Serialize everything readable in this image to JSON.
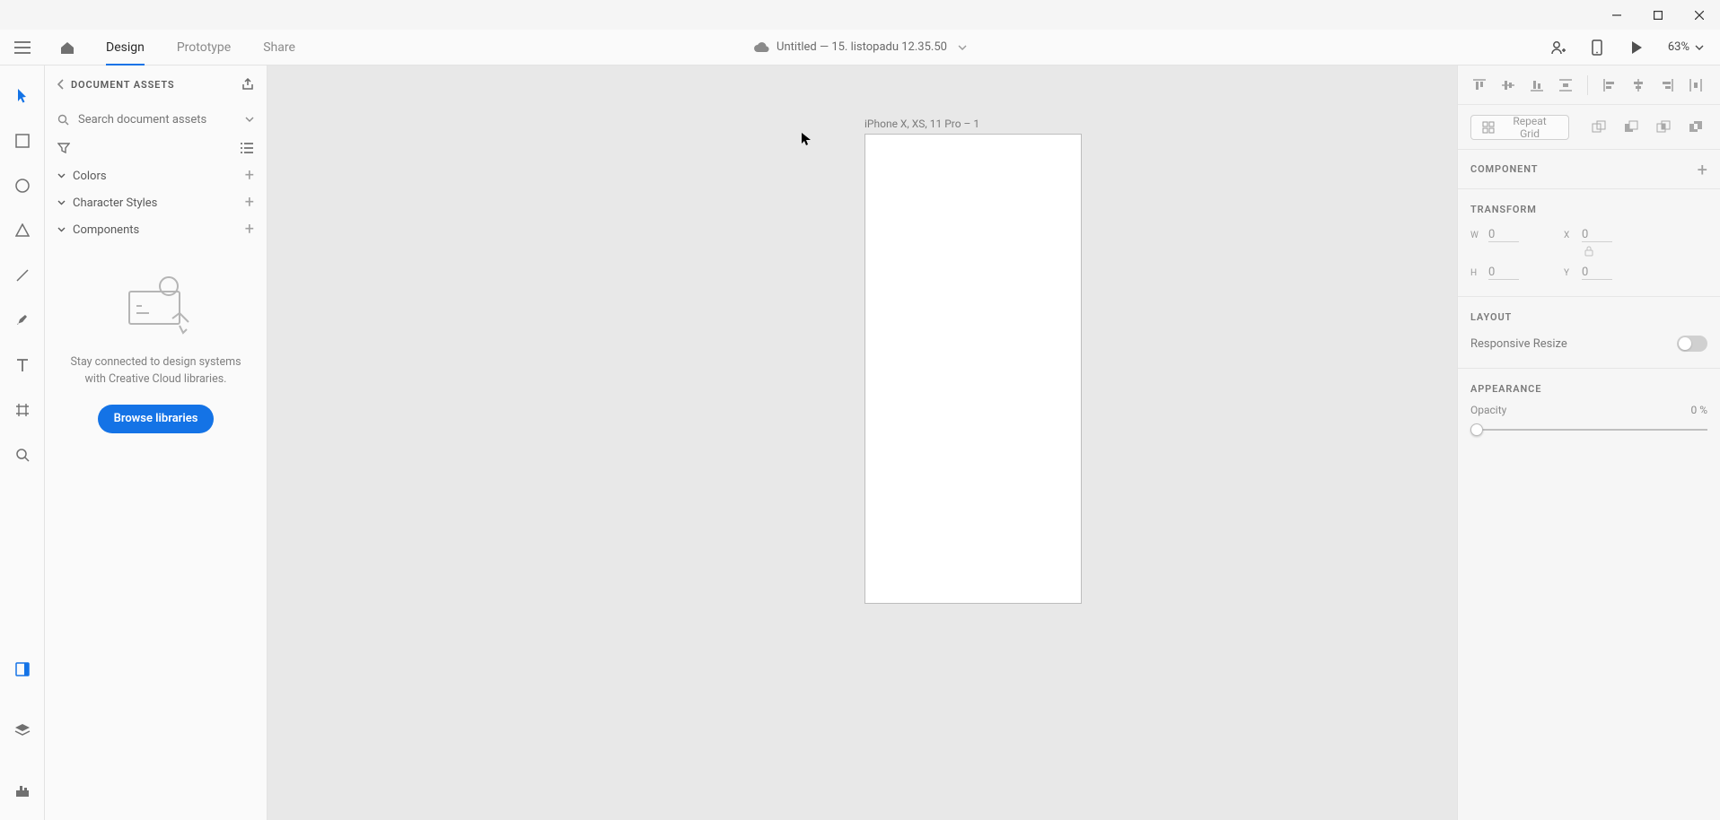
{
  "window": {
    "title": ""
  },
  "header": {
    "tabs": [
      "Design",
      "Prototype",
      "Share"
    ],
    "active_tab": 0,
    "doc_title": "Untitled — 15. listopadu 12.35.50",
    "zoom_label": "63%"
  },
  "assets": {
    "title": "DOCUMENT ASSETS",
    "search_placeholder": "Search document assets",
    "sections": {
      "colors": "Colors",
      "chars": "Character Styles",
      "components": "Components"
    },
    "empty_msg": "Stay connected to design systems with Creative Cloud libraries.",
    "browse_btn": "Browse libraries"
  },
  "canvas": {
    "artboard_label": "iPhone X, XS, 11 Pro – 1"
  },
  "rpanel": {
    "repeat_label": "Repeat Grid",
    "component_title": "COMPONENT",
    "transform_title": "TRANSFORM",
    "transform": {
      "w_label": "W",
      "w": "0",
      "h_label": "H",
      "h": "0",
      "x_label": "X",
      "x": "0",
      "y_label": "Y",
      "y": "0"
    },
    "layout_title": "LAYOUT",
    "responsive_label": "Responsive Resize",
    "appearance_title": "APPEARANCE",
    "opacity_label": "Opacity",
    "opacity_value": "0 %"
  }
}
